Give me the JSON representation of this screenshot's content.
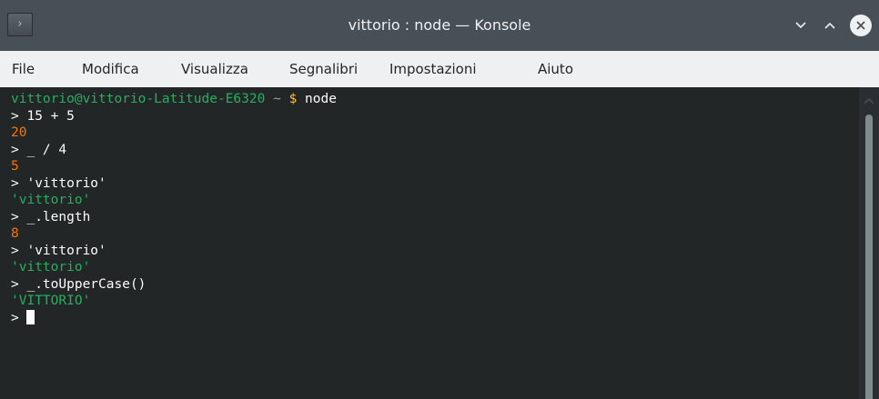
{
  "window": {
    "title": "vittorio : node — Konsole",
    "app_icon_glyph": "›"
  },
  "menu": {
    "items": [
      "File",
      "Modifica",
      "Visualizza",
      "Segnalibri",
      "Impostazioni",
      "Aiuto"
    ]
  },
  "terminal": {
    "prompt_host": "vittorio@vittorio-Latitude-E6320",
    "prompt_path": " ~ ",
    "prompt_symbol": "$",
    "command": " node",
    "lines": [
      {
        "kind": "input",
        "text": "> 15 + 5"
      },
      {
        "kind": "number",
        "text": "20"
      },
      {
        "kind": "input",
        "text": "> _ / 4"
      },
      {
        "kind": "number",
        "text": "5"
      },
      {
        "kind": "input",
        "text": "> 'vittorio'"
      },
      {
        "kind": "string",
        "text": "'vittorio'"
      },
      {
        "kind": "input",
        "text": "> _.length"
      },
      {
        "kind": "number",
        "text": "8"
      },
      {
        "kind": "input",
        "text": "> 'vittorio'"
      },
      {
        "kind": "string",
        "text": "'vittorio'"
      },
      {
        "kind": "input",
        "text": "> _.toUpperCase()"
      },
      {
        "kind": "string",
        "text": "'VITTORIO'"
      }
    ],
    "current_prompt": "> "
  },
  "colors": {
    "titlebar": "#475057",
    "menubar": "#eff0f1",
    "terminal_bg": "#232627",
    "number": "#f67400",
    "string": "#27ae60",
    "host": "#27ae60",
    "symbol": "#fdbc4b"
  },
  "icons": {
    "minimize": "chevron-down-icon",
    "maximize": "chevron-up-icon",
    "close": "close-icon",
    "scroll_up": "chevron-up-icon"
  }
}
